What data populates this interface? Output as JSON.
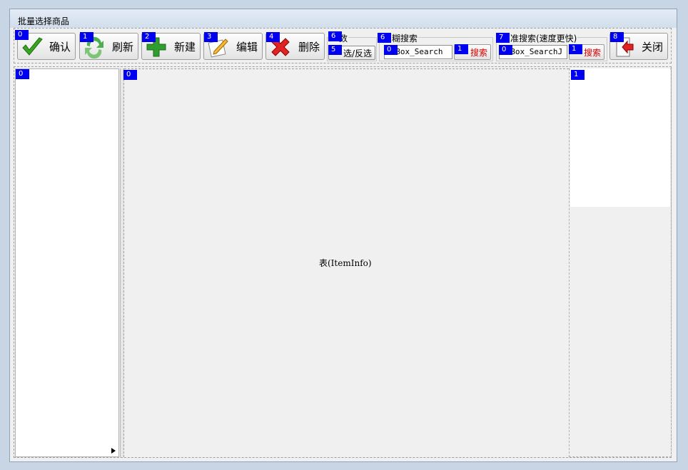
{
  "window": {
    "title": "批量选择商品"
  },
  "toolbar": {
    "buttons": [
      {
        "badge": "0",
        "label": "确认"
      },
      {
        "badge": "1",
        "label": "刷新"
      },
      {
        "badge": "2",
        "label": "新建"
      },
      {
        "badge": "3",
        "label": "编辑"
      },
      {
        "badge": "4",
        "label": "删除"
      },
      {
        "badge": "8",
        "label": "关闭"
      }
    ],
    "select_group": {
      "badge": "6",
      "label": "数",
      "button_badge": "5",
      "button_label": "选/反选"
    },
    "fuzzy_search": {
      "badge": "6",
      "label": "糊搜索",
      "input_badge": "0",
      "input_value": "xtBox_Search",
      "button_badge": "1",
      "button_label": "搜索"
    },
    "exact_search": {
      "badge": "7",
      "label": "准搜索(速度更快)",
      "input_badge": "0",
      "input_value": "xtBox_SearchJ",
      "button_badge": "1",
      "button_label": "搜索"
    }
  },
  "panels": {
    "left_badge": "0",
    "main_badge": "0",
    "main_text": "表(ItemInfo)",
    "right_badge": "1"
  },
  "colors": {
    "badge": "#0000f0",
    "search_text": "#d40000"
  },
  "icons": [
    "check-icon",
    "refresh-icon",
    "plus-icon",
    "edit-icon",
    "delete-icon",
    "close-icon",
    "search-icon"
  ]
}
